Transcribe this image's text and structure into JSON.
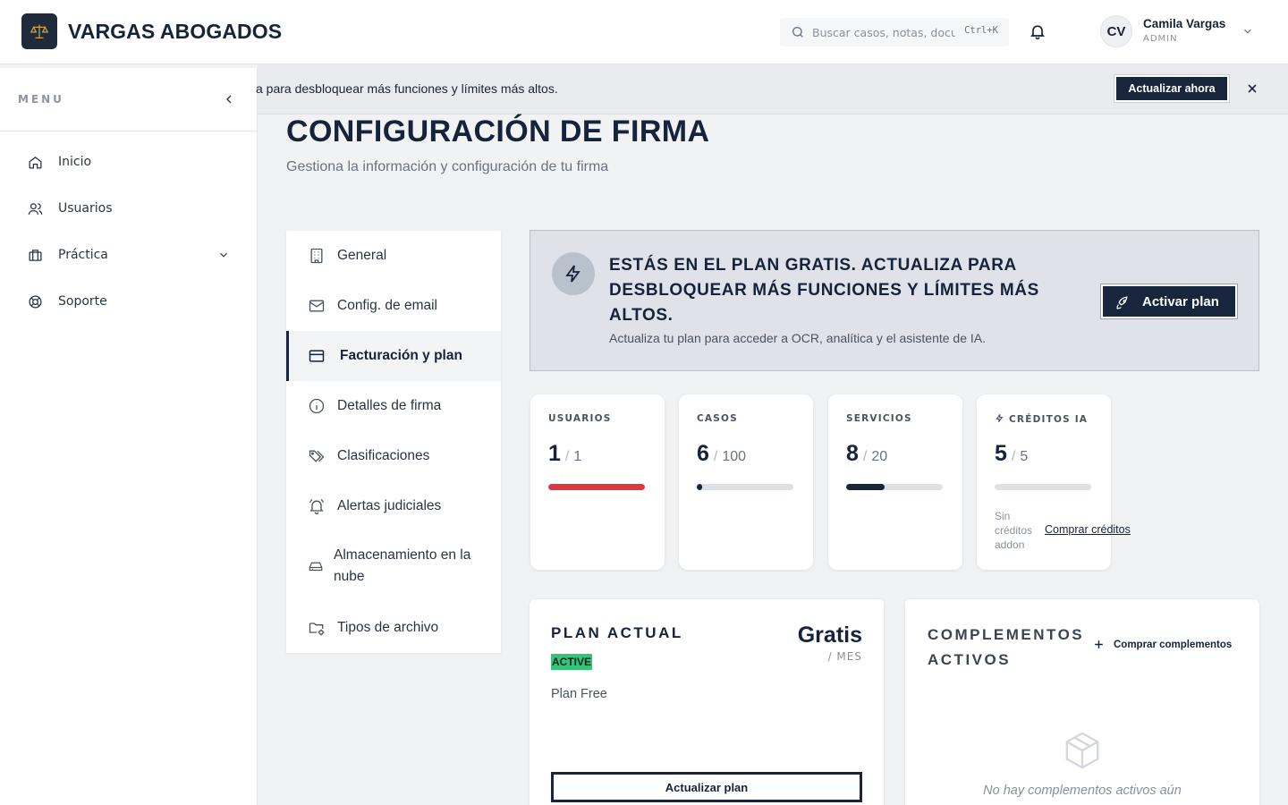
{
  "header": {
    "brand": "VARGAS ABOGADOS",
    "search_placeholder": "Buscar casos, notas, documentos...",
    "search_shortcut": "Ctrl+K",
    "user": {
      "initials": "CV",
      "name": "Camila Vargas",
      "role": "ADMIN"
    }
  },
  "sidebar": {
    "menu_label": "MENU",
    "items": [
      {
        "label": "Inicio",
        "icon": "home-icon"
      },
      {
        "label": "Usuarios",
        "icon": "users-icon"
      },
      {
        "label": "Práctica",
        "icon": "briefcase-icon",
        "expandable": true
      },
      {
        "label": "Soporte",
        "icon": "lifebuoy-icon"
      }
    ]
  },
  "banner": {
    "text": "a para desbloquear más funciones y límites más altos.",
    "button": "Actualizar ahora"
  },
  "page": {
    "title": "CONFIGURACIÓN DE FIRMA",
    "subtitle": "Gestiona la información y configuración de tu firma"
  },
  "settings_nav": {
    "active_index": 2,
    "items": [
      {
        "label": "General",
        "icon": "building-icon"
      },
      {
        "label": "Config. de email",
        "icon": "mail-icon"
      },
      {
        "label": "Facturación y plan",
        "icon": "credit-card-icon"
      },
      {
        "label": "Detalles de firma",
        "icon": "info-icon"
      },
      {
        "label": "Clasificaciones",
        "icon": "tags-icon"
      },
      {
        "label": "Alertas judiciales",
        "icon": "bell-ring-icon"
      },
      {
        "label": "Almacenamiento en la nube",
        "icon": "hard-drive-icon"
      },
      {
        "label": "Tipos de archivo",
        "icon": "folder-cog-icon"
      }
    ]
  },
  "upgrade": {
    "title": "ESTÁS EN EL PLAN GRATIS. ACTUALIZA PARA DESBLOQUEAR MÁS FUNCIONES Y LÍMITES MÁS ALTOS.",
    "subtitle": "Actualiza tu plan para acceder a OCR, analítica y el asistente de IA.",
    "button": "Activar plan"
  },
  "stats": [
    {
      "label": "USUARIOS",
      "value": "1",
      "max": "1",
      "fill": 1.0,
      "color": "#e0373f"
    },
    {
      "label": "CASOS",
      "value": "6",
      "max": "100",
      "fill": 0.06,
      "color": "#17263c"
    },
    {
      "label": "SERVICIOS",
      "value": "8",
      "max": "20",
      "fill": 0.4,
      "color": "#17263c"
    },
    {
      "label": "CRÉDITOS IA",
      "value": "5",
      "max": "5",
      "fill": 0.0,
      "color": "#17263c",
      "note": "Sin créditos addon",
      "link": "Comprar créditos"
    }
  ],
  "plan": {
    "title": "PLAN ACTUAL",
    "badge": "ACTIVE",
    "price": "Gratis",
    "period": "/ MES",
    "name": "Plan Free",
    "button": "Actualizar plan"
  },
  "addons": {
    "title": "COMPLEMENTOS ACTIVOS",
    "button": "Comprar complementos",
    "empty": "No hay complementos activos aún"
  },
  "colors": {
    "primary": "#17263c",
    "danger": "#e0373f",
    "success": "#35c47a"
  }
}
